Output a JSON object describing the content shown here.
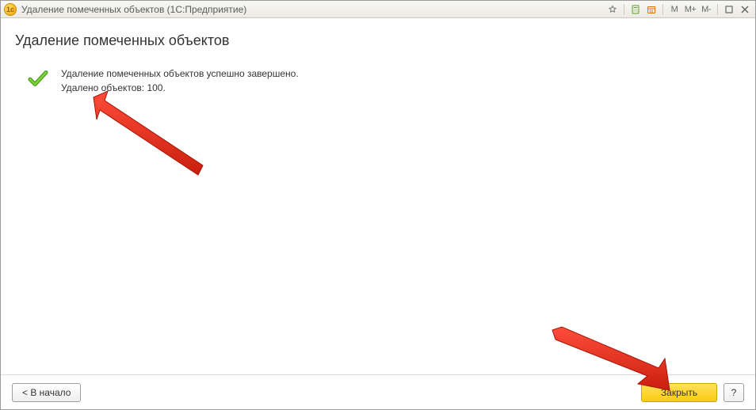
{
  "titlebar": {
    "title": "Удаление помеченных объектов  (1С:Предприятие)",
    "mem_m": "M",
    "mem_mplus": "M+",
    "mem_mminus": "M-"
  },
  "page": {
    "heading": "Удаление помеченных объектов"
  },
  "result": {
    "line1": "Удаление помеченных объектов успешно завершено.",
    "line2": "Удалено объектов: 100."
  },
  "footer": {
    "back_label": "< В начало",
    "close_label": "Закрыть",
    "help_label": "?"
  }
}
